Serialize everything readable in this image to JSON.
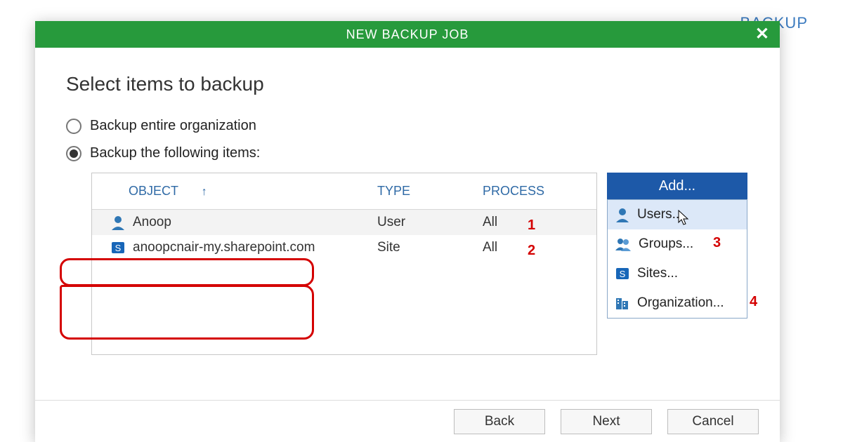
{
  "bg_text": "BACKUP",
  "titlebar": {
    "title": "NEW BACKUP JOB"
  },
  "heading": "Select items to backup",
  "radios": {
    "entire": "Backup entire organization",
    "following": "Backup the following items:"
  },
  "grid": {
    "headers": {
      "object": "OBJECT",
      "type": "TYPE",
      "process": "PROCESS"
    },
    "rows": [
      {
        "object": "Anoop",
        "icon": "user",
        "type": "User",
        "process": "All",
        "annot": "1",
        "selected": true
      },
      {
        "object": "anoopcnair-my.sharepoint.com",
        "icon": "site",
        "type": "Site",
        "process": "All",
        "annot": "2",
        "selected": false
      }
    ]
  },
  "add_button": "Add...",
  "menu": {
    "items": [
      {
        "icon": "user",
        "label": "Users...",
        "hover": true
      },
      {
        "icon": "group",
        "label": "Groups...",
        "annot": "3"
      },
      {
        "icon": "site",
        "label": "Sites..."
      },
      {
        "icon": "org",
        "label": "Organization...",
        "annot": "4"
      }
    ]
  },
  "footer": {
    "back": "Back",
    "next": "Next",
    "cancel": "Cancel"
  }
}
